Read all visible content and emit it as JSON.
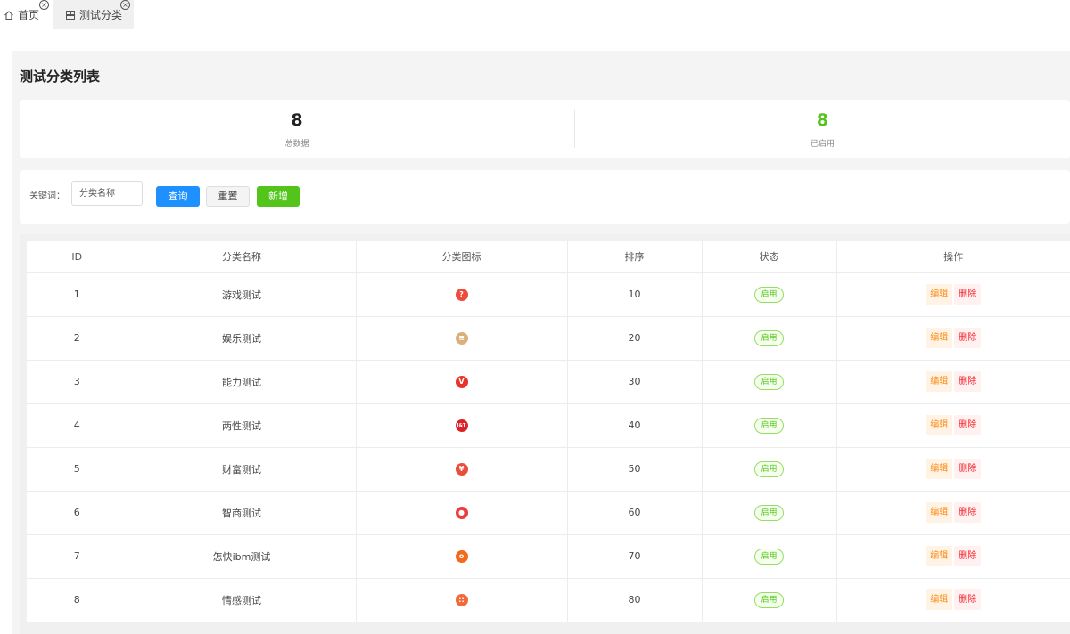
{
  "tabs": [
    {
      "label": "首页",
      "icon": "home-icon"
    },
    {
      "label": "测试分类",
      "icon": "category-icon"
    }
  ],
  "page_title": "测试分类列表",
  "stats": {
    "total": {
      "value": "8",
      "label": "总数据"
    },
    "enabled": {
      "value": "8",
      "label": "已启用",
      "color": "#52c41a"
    }
  },
  "filter": {
    "keyword_label": "关键词：",
    "keyword_placeholder": "分类名称",
    "query_label": "查询",
    "reset_label": "重置",
    "add_label": "新增"
  },
  "table": {
    "headers": [
      "ID",
      "分类名称",
      "分类图标",
      "排序",
      "状态",
      "操作"
    ],
    "rows": [
      {
        "id": "1",
        "name": "游戏测试",
        "icon": "question-icon",
        "icon_color": "#f04a3a",
        "icon_glyph": "?",
        "sort": "10",
        "status": "启用"
      },
      {
        "id": "2",
        "name": "娱乐测试",
        "icon": "entertainment-icon",
        "icon_color": "#d8b27a",
        "icon_glyph": "≡",
        "sort": "20",
        "status": "启用"
      },
      {
        "id": "3",
        "name": "能力测试",
        "icon": "v-icon",
        "icon_color": "#e8332a",
        "icon_glyph": "V",
        "sort": "30",
        "status": "启用"
      },
      {
        "id": "4",
        "name": "两性测试",
        "icon": "jt-icon",
        "icon_color": "#d8232a",
        "icon_glyph": "J&T",
        "sort": "40",
        "status": "启用"
      },
      {
        "id": "5",
        "name": "财富测试",
        "icon": "wealth-icon",
        "icon_color": "#e94e3c",
        "icon_glyph": "¥",
        "sort": "50",
        "status": "启用"
      },
      {
        "id": "6",
        "name": "智商测试",
        "icon": "user-icon",
        "icon_color": "#ec3e3e",
        "icon_glyph": "●",
        "sort": "60",
        "status": "启用"
      },
      {
        "id": "7",
        "name": "怎快ibm测试",
        "icon": "ring-icon",
        "icon_color": "#f26a1b",
        "icon_glyph": "o",
        "sort": "70",
        "status": "启用"
      },
      {
        "id": "8",
        "name": "情感测试",
        "icon": "grid-icon",
        "icon_color": "#f26a3a",
        "icon_glyph": "::",
        "sort": "80",
        "status": "启用"
      }
    ],
    "edit_label": "编辑",
    "delete_label": "删除"
  }
}
